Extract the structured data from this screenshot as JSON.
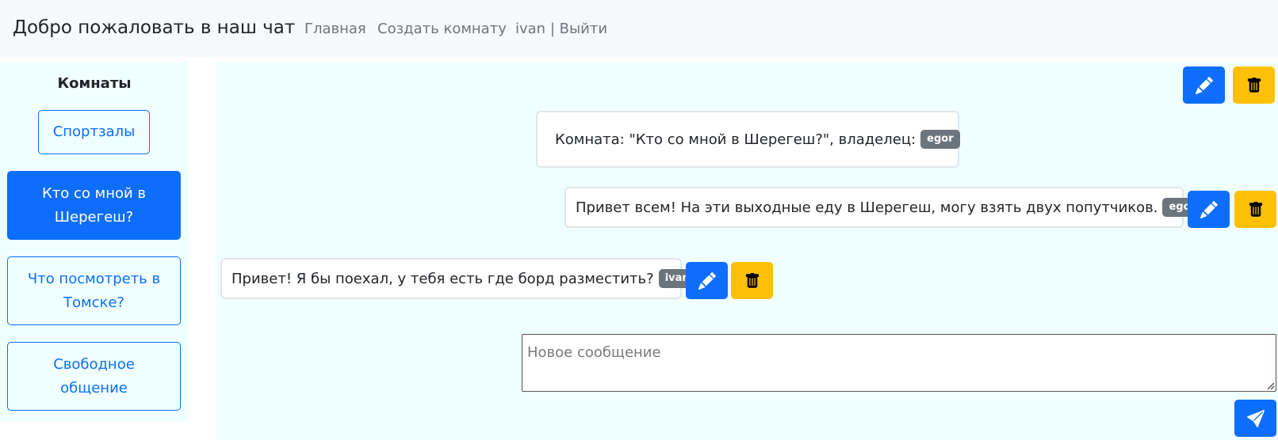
{
  "navbar": {
    "brand": "Добро пожаловать в наш чат",
    "links": [
      "Главная",
      "Создать комнату",
      "ivan | Выйти"
    ]
  },
  "sidebar": {
    "title": "Комнаты",
    "rooms": [
      {
        "label": "Спортзалы",
        "active": false
      },
      {
        "label": "Кто со мной в Шерегеш?",
        "active": true
      },
      {
        "label": "Что посмотреть в Томске?",
        "active": false
      },
      {
        "label": "Свободное общение",
        "active": false
      }
    ]
  },
  "chat": {
    "room_info": {
      "text": "Комната: \"Кто со мной в Шерегеш?\", владелец:",
      "owner": "egor"
    },
    "messages": [
      {
        "text": "Привет всем! На эти выходные еду в Шерегеш, могу взять двух попутчиков.",
        "author": "egor"
      },
      {
        "text": "Привет! Я бы поехал, у тебя есть где борд разместить?",
        "author": "ivan"
      }
    ],
    "input": {
      "placeholder": "Новое сообщение",
      "value": ""
    }
  },
  "icons": {
    "edit": "pencil-icon",
    "delete": "trash-icon",
    "send": "send-icon"
  },
  "colors": {
    "primary": "#0d6efd",
    "warning": "#ffc107",
    "secondary": "#6c757d",
    "panel_bg": "#f0ffff",
    "navbar_bg": "#f8f9fa"
  }
}
